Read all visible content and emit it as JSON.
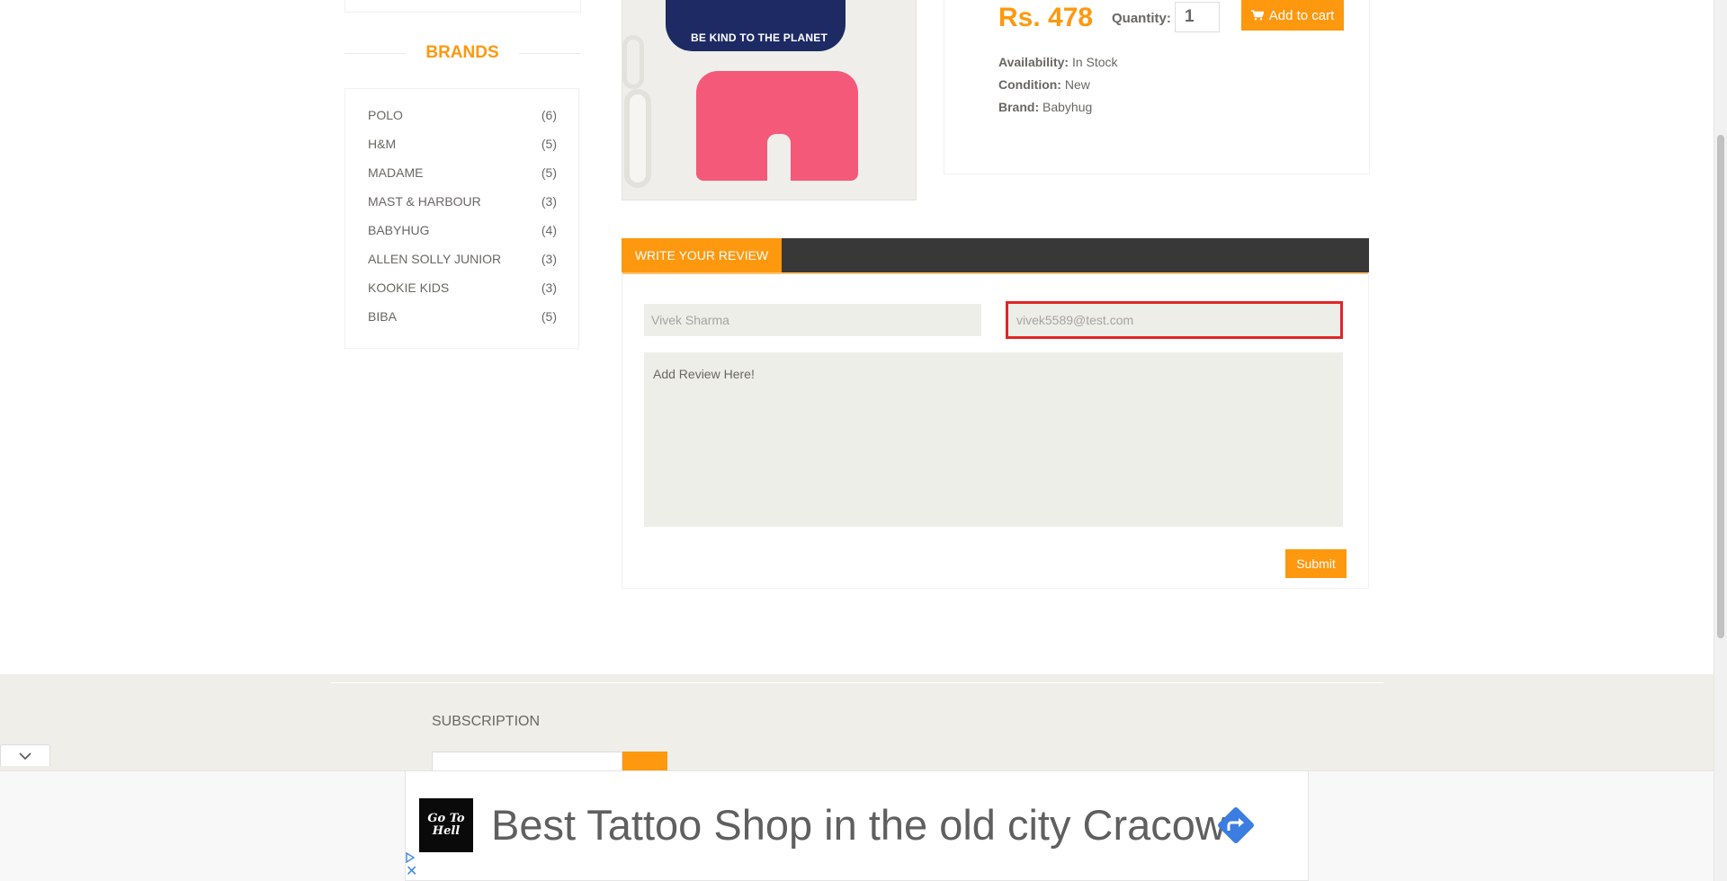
{
  "sidebar": {
    "brands_title": "BRANDS",
    "brands": [
      {
        "name": "POLO",
        "count": "(6)"
      },
      {
        "name": "H&M",
        "count": "(5)"
      },
      {
        "name": "MADAME",
        "count": "(5)"
      },
      {
        "name": "MAST & HARBOUR",
        "count": "(3)"
      },
      {
        "name": "BABYHUG",
        "count": "(4)"
      },
      {
        "name": "ALLEN SOLLY JUNIOR",
        "count": "(3)"
      },
      {
        "name": "KOOKIE KIDS",
        "count": "(3)"
      },
      {
        "name": "BIBA",
        "count": "(5)"
      }
    ]
  },
  "product": {
    "image_text": "BE KIND TO THE PLANET",
    "price": "Rs. 478",
    "quantity_label": "Quantity:",
    "quantity_value": "1",
    "add_to_cart_label": "Add to cart",
    "availability_label": "Availability:",
    "availability_value": "In Stock",
    "condition_label": "Condition:",
    "condition_value": "New",
    "brand_label": "Brand:",
    "brand_value": "Babyhug"
  },
  "review": {
    "tab_label": "WRITE YOUR REVIEW",
    "name_value": "Vivek Sharma",
    "email_value": "vivek5589@test.com",
    "review_placeholder": "Add Review Here!",
    "submit_label": "Submit"
  },
  "footer": {
    "subscription_title": "SUBSCRIPTION"
  },
  "ad": {
    "logo_text": "Go To Hell",
    "text": "Best Tattoo Shop in the old city Cracow",
    "close_glyph": "✕"
  },
  "colors": {
    "accent": "#fe980f",
    "dark_bar": "#383838",
    "field_bg": "#eeeee8",
    "error_border": "#e02626"
  }
}
